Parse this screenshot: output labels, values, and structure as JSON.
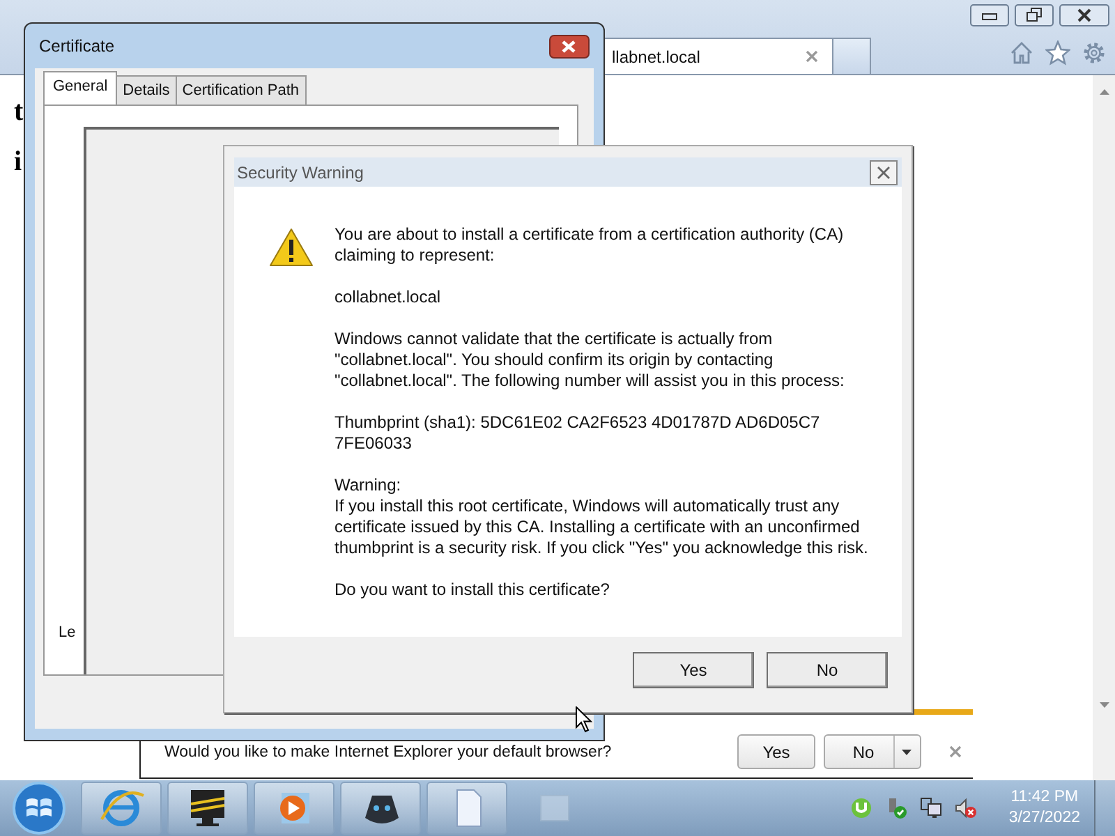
{
  "browser": {
    "tab": {
      "title": "llabnet.local"
    },
    "page_fragments": [
      "t",
      "i"
    ],
    "notification": {
      "text": "Would you like to make Internet Explorer your default browser?",
      "buttons": [
        "Yes",
        "No"
      ]
    }
  },
  "certificate_dialog": {
    "title": "Certificate",
    "tabs": [
      {
        "label": "General",
        "selected": true
      },
      {
        "label": "Details",
        "selected": false
      },
      {
        "label": "Certification Path",
        "selected": false
      }
    ],
    "panel_text": "Le"
  },
  "security_warning": {
    "title": "Security Warning",
    "paragraphs": [
      {
        "kind": "text",
        "text": "You are about to install a certificate from a certification authority (CA) claiming to represent:"
      },
      {
        "kind": "text",
        "text": "collabnet.local"
      },
      {
        "kind": "text",
        "text": "Windows cannot validate that the certificate is actually from \"collabnet.local\". You should confirm its origin by contacting \"collabnet.local\". The following number will assist you in this process:"
      },
      {
        "kind": "text",
        "text": "Thumbprint (sha1): 5DC61E02 CA2F6523 4D01787D AD6D05C7 7FE06033"
      },
      {
        "kind": "heading",
        "text": "Warning:"
      },
      {
        "kind": "text",
        "text": "If you install this root certificate, Windows will automatically trust any certificate issued by this CA. Installing a certificate with an unconfirmed thumbprint is a security risk. If you click \"Yes\" you acknowledge this risk."
      },
      {
        "kind": "text",
        "text": "Do you want to install this certificate?"
      }
    ],
    "buttons": [
      "Yes",
      "No"
    ]
  },
  "taskbar": {
    "clock": {
      "time": "11:42 PM",
      "date": "3/27/2022"
    }
  }
}
